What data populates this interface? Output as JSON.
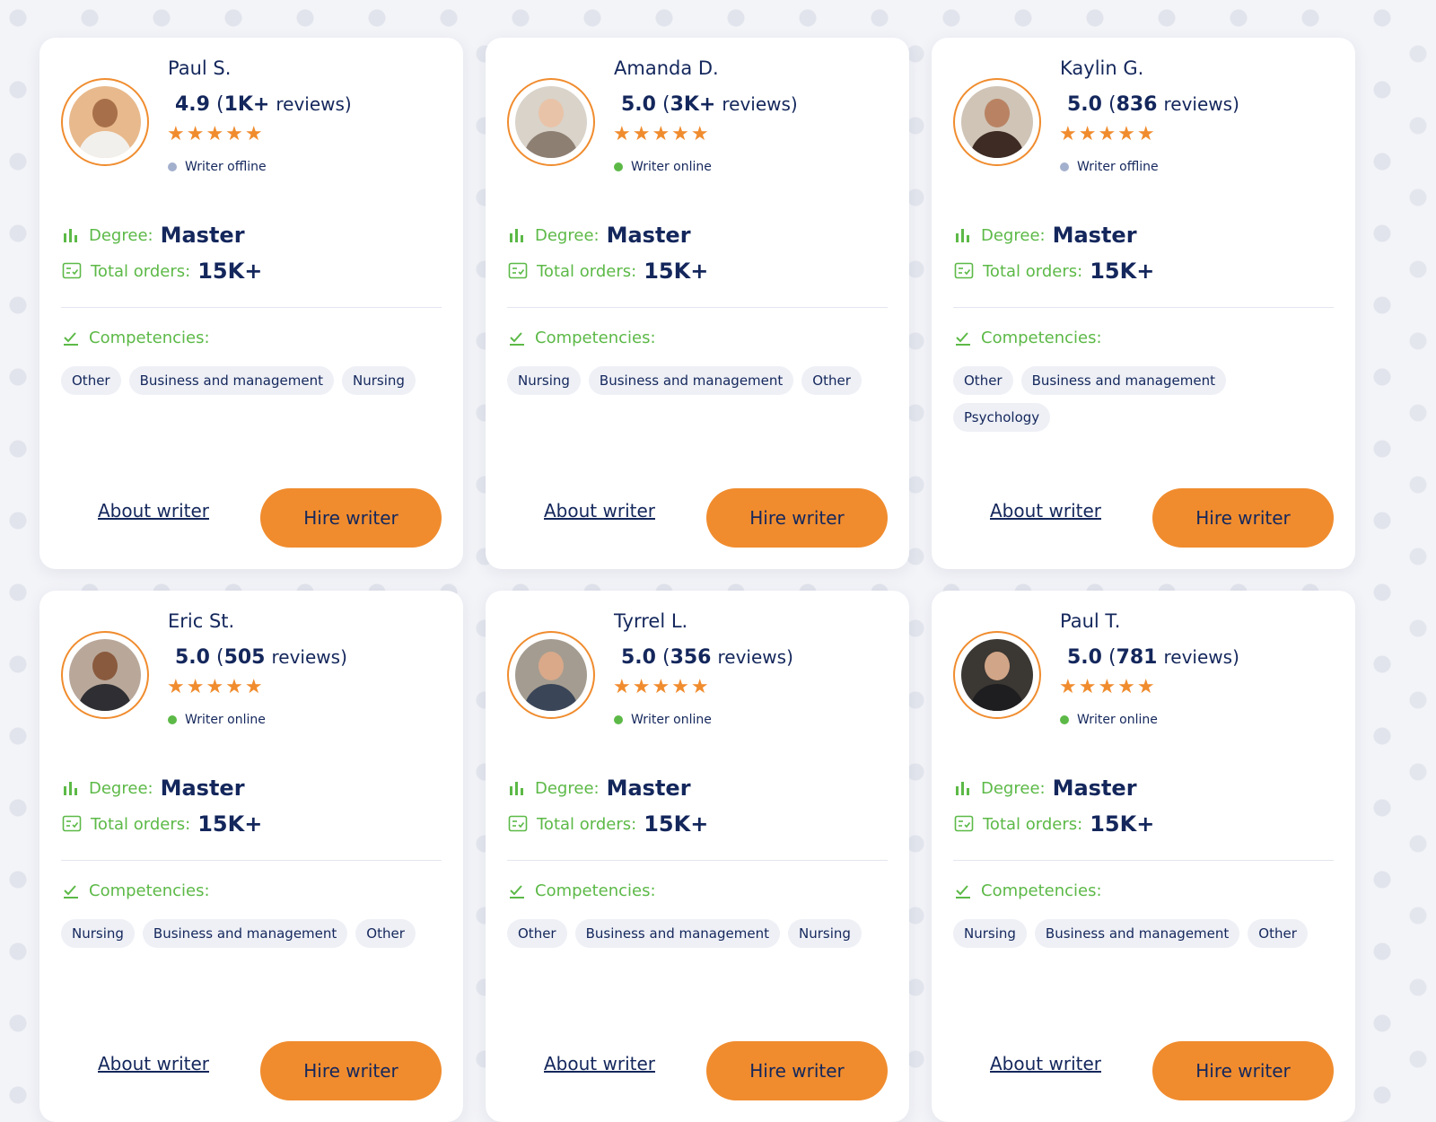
{
  "labels": {
    "degree": "Degree:",
    "total_orders": "Total orders:",
    "competencies": "Competencies:",
    "reviews": "reviews)",
    "about_button": "About writer",
    "hire_button": "Hire writer",
    "stars": "★★★★★"
  },
  "colors": {
    "accent": "#f08c2e",
    "navy": "#14275c",
    "green": "#5cb947",
    "offline_dot": "#a3b0cd"
  },
  "writers": [
    {
      "name": "Paul S.",
      "score": "4.9",
      "review_count": "1K+",
      "status": "Writer offline",
      "online": false,
      "degree": "Master",
      "orders": "15K+",
      "competencies": [
        "Other",
        "Business and management",
        "Nursing"
      ]
    },
    {
      "name": "Amanda D.",
      "score": "5.0",
      "review_count": "3K+",
      "status": "Writer online",
      "online": true,
      "degree": "Master",
      "orders": "15K+",
      "competencies": [
        "Nursing",
        "Business and management",
        "Other"
      ]
    },
    {
      "name": "Kaylin G.",
      "score": "5.0",
      "review_count": "836",
      "status": "Writer offline",
      "online": false,
      "degree": "Master",
      "orders": "15K+",
      "competencies": [
        "Other",
        "Business and management",
        "Psychology"
      ]
    },
    {
      "name": "Eric St.",
      "score": "5.0",
      "review_count": "505",
      "status": "Writer online",
      "online": true,
      "degree": "Master",
      "orders": "15K+",
      "competencies": [
        "Nursing",
        "Business and management",
        "Other"
      ]
    },
    {
      "name": "Tyrrel L.",
      "score": "5.0",
      "review_count": "356",
      "status": "Writer online",
      "online": true,
      "degree": "Master",
      "orders": "15K+",
      "competencies": [
        "Other",
        "Business and management",
        "Nursing"
      ]
    },
    {
      "name": "Paul T.",
      "score": "5.0",
      "review_count": "781",
      "status": "Writer online",
      "online": true,
      "degree": "Master",
      "orders": "15K+",
      "competencies": [
        "Nursing",
        "Business and management",
        "Other"
      ]
    }
  ]
}
